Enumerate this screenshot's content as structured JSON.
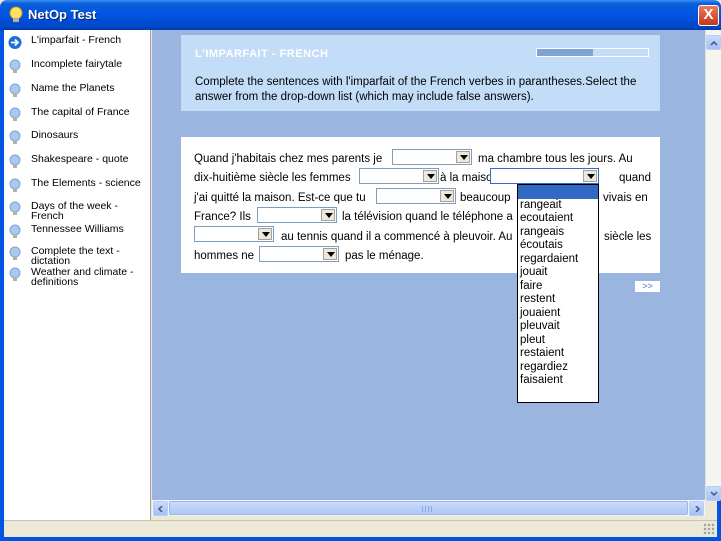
{
  "window": {
    "title": "NetOp Test",
    "close_label": "X"
  },
  "sidebar": {
    "items": [
      {
        "label": "L'imparfait - French",
        "active": true
      },
      {
        "label": "Incomplete fairytale"
      },
      {
        "label": "Name the Planets"
      },
      {
        "label": "The capital of France"
      },
      {
        "label": "Dinosaurs"
      },
      {
        "label": "Shakespeare - quote"
      },
      {
        "label": "The Elements - science"
      },
      {
        "label": "Days of the week - French"
      },
      {
        "label": "Tennessee Williams"
      },
      {
        "label": "Complete the text - dictation"
      },
      {
        "label": "Weather and climate - definitions"
      }
    ]
  },
  "exercise": {
    "title": "L'IMPARFAIT - FRENCH",
    "progress": 0.5,
    "instructions": "Complete the sentences with l'imparfait of the French verbes in parantheses.Select the answer from the drop-down list (which may include false answers).",
    "segments": {
      "s1": "Quand j'habitais chez mes parents je",
      "s2": "ma chambre tous les jours. Au",
      "s3": "dix-huitième siècle les femmes",
      "s4": "à la maison. Il",
      "s5": "quand",
      "s6": "j'ai quitté la maison. Est-ce que tu",
      "s7": "beaucoup",
      "s8": "vivais en",
      "s9": "France? Ils",
      "s10": "la télévision quand le téléphone a",
      "s11": "au tennis quand il a commencé à pleuvoir. Au",
      "s12": "siècle les",
      "s13": "hommes ne",
      "s14": "pas le ménage."
    },
    "next_label": ">>"
  },
  "dropdown": {
    "options": [
      "",
      "rangeait",
      "ecoutaient",
      "rangeais",
      "écoutais",
      "regardaient",
      "jouait",
      "faire",
      "restent",
      "jouaient",
      "pleuvait",
      "pleut",
      "restaient",
      "regardiez",
      "faisaient"
    ],
    "selected_index": 0
  },
  "scrollbar": {
    "h_grip": "III"
  }
}
